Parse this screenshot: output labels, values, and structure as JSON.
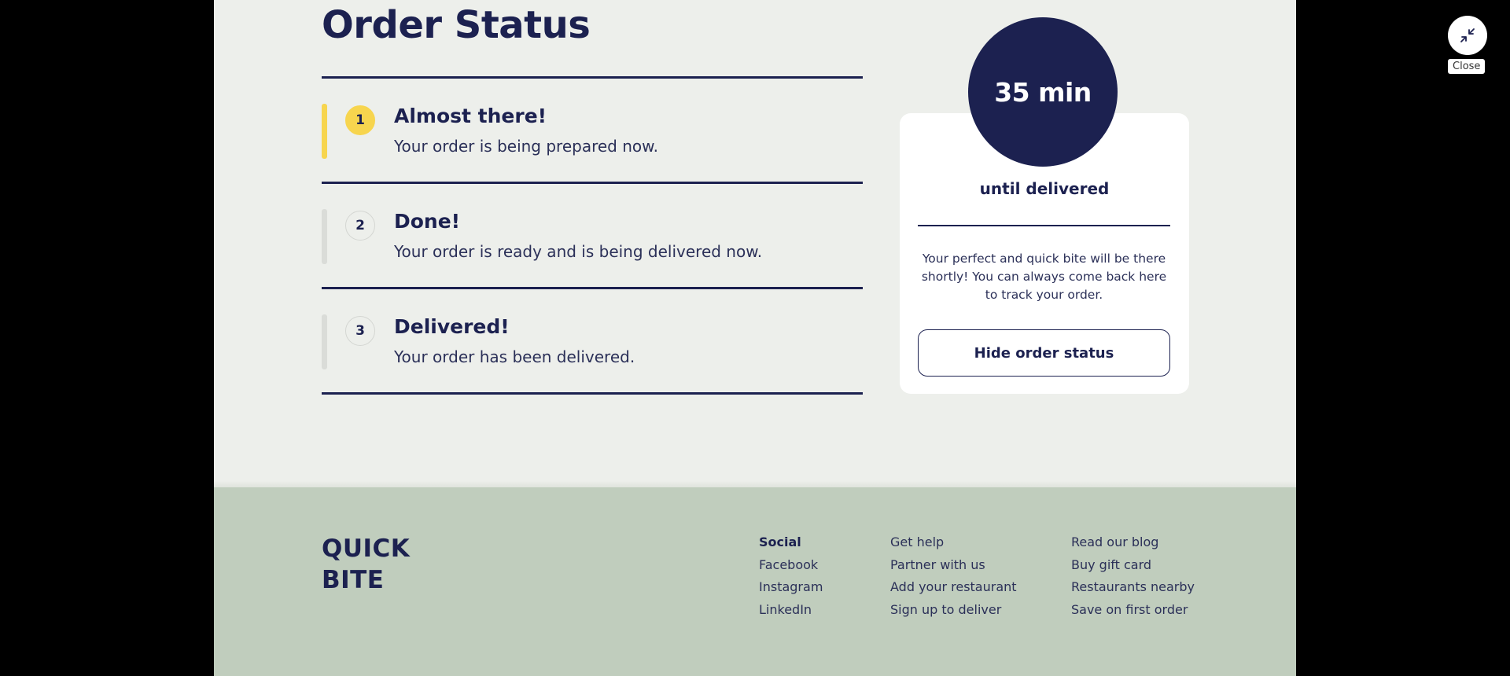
{
  "page": {
    "title": "Order Status"
  },
  "steps": [
    {
      "number": "1",
      "title": "Almost there!",
      "description": "Your order is being prepared now.",
      "active": true
    },
    {
      "number": "2",
      "title": "Done!",
      "description": "Your order is ready and is being delivered now.",
      "active": false
    },
    {
      "number": "3",
      "title": "Delivered!",
      "description": "Your order has been delivered.",
      "active": false
    }
  ],
  "delivery_card": {
    "time": "35 min",
    "until_label": "until delivered",
    "message": "Your perfect and quick bite will be there shortly! You can always come back here to track your order.",
    "hide_button": "Hide order status"
  },
  "footer": {
    "logo_line1": "QUICK",
    "logo_line2": "BITE",
    "social": {
      "heading": "Social",
      "links": [
        "Facebook",
        "Instagram",
        "LinkedIn"
      ]
    },
    "help_links": [
      "Get help",
      "Partner with us",
      "Add your restaurant",
      "Sign up to deliver"
    ],
    "more_links": [
      "Read our blog",
      "Buy gift card",
      "Restaurants nearby",
      "Save on first order"
    ]
  },
  "overlay": {
    "close_label": "Close",
    "close_icon": "minimize-arrows-icon"
  },
  "colors": {
    "navy": "#1c2150",
    "accent_yellow": "#f7d54e",
    "page_bg": "#edefeb",
    "footer_bg": "#c0cdbd"
  }
}
